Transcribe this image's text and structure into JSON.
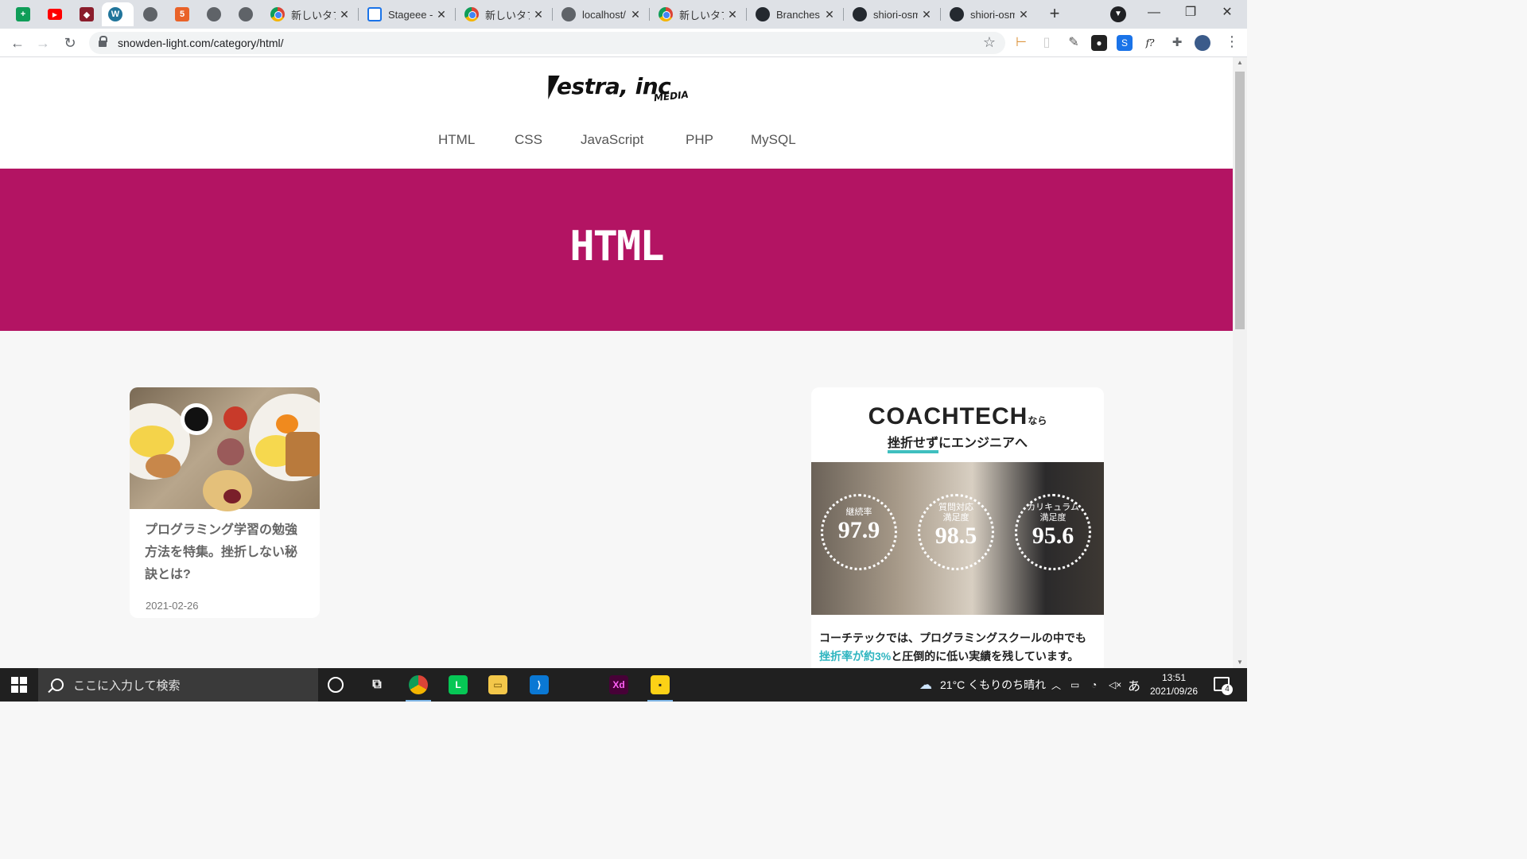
{
  "browser": {
    "tabs": [
      {
        "title": "",
        "icon": "google-sheets-icon",
        "active": false
      },
      {
        "title": "",
        "icon": "youtube-icon",
        "active": false
      },
      {
        "title": "",
        "icon": "app-icon",
        "active": false
      },
      {
        "title": "",
        "icon": "wordpress-icon",
        "active": true
      },
      {
        "title": "",
        "icon": "globe-icon",
        "active": false
      },
      {
        "title": "",
        "icon": "html5-icon",
        "active": false
      },
      {
        "title": "",
        "icon": "globe-icon",
        "active": false
      },
      {
        "title": "",
        "icon": "globe-icon",
        "active": false
      },
      {
        "title": "新しいタブ",
        "icon": "chrome-icon",
        "active": false
      },
      {
        "title": "Stageee -",
        "icon": "stageee-icon",
        "active": false
      },
      {
        "title": "新しいタブ",
        "icon": "chrome-icon",
        "active": false
      },
      {
        "title": "localhost/",
        "icon": "globe-icon",
        "active": false
      },
      {
        "title": "新しいタブ",
        "icon": "chrome-icon",
        "active": false
      },
      {
        "title": "Branches",
        "icon": "github-icon",
        "active": false
      },
      {
        "title": "shiori-osm",
        "icon": "github-icon",
        "active": false
      },
      {
        "title": "shiori-osm",
        "icon": "github-icon",
        "active": false
      }
    ],
    "tab_close_glyph": "✕",
    "new_tab_glyph": "+",
    "url": "snowden-light.com/category/html/"
  },
  "site": {
    "logo_word": "estra, inc",
    "logo_sub": "MEDIA",
    "nav": [
      "HTML",
      "CSS",
      "JavaScript",
      "PHP",
      "MySQL"
    ],
    "hero_title": "HTML",
    "hero_color": "#b31463"
  },
  "post": {
    "title": "プログラミング学習の勉強方法を特集。挫折しない秘訣とは?",
    "date": "2021-02-26"
  },
  "ad": {
    "brand": "COACHTECH",
    "brand_suffix": "なら",
    "tagline_highlight": "挫折せず",
    "tagline_rest": "にエンジニアへ",
    "stats": [
      {
        "label": "継続率",
        "value": "97.9"
      },
      {
        "label": "質問対応\n満足度",
        "value": "98.5"
      },
      {
        "label": "カリキュラム\n満足度",
        "value": "95.6"
      }
    ],
    "copy_line1": "コーチテックでは、プログラミングスクールの中でも",
    "copy_accent": "挫折率が約3%",
    "copy_line2_rest": "と圧倒的に低い実績を残しています。"
  },
  "taskbar": {
    "search_placeholder": "ここに入力して検索",
    "weather": "21°C くもりのち晴れ",
    "ime": "あ",
    "time": "13:51",
    "date": "2021/09/26",
    "notification_count": "4"
  }
}
